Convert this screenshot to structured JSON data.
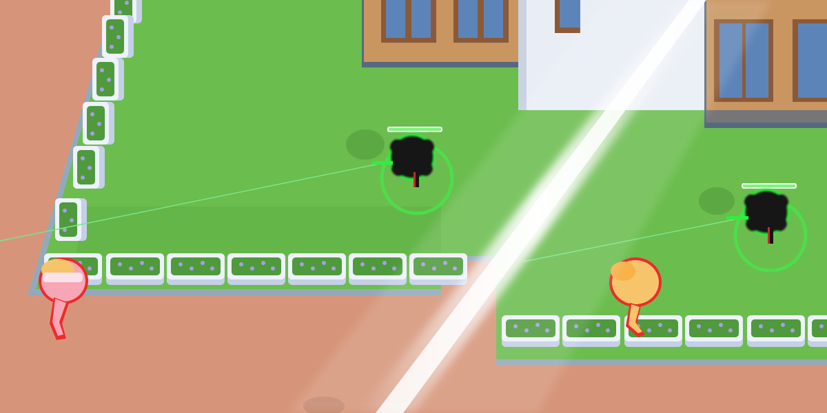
{
  "scene": {
    "colors": {
      "ground": "#d6957a",
      "lawn": "#6bbd4e",
      "lawn_shadow": "#5aa843",
      "curb": "#93a9ba",
      "planter": "#eef2fb",
      "planter_shade": "#c4d0e6",
      "flowers": "#4f9a3c",
      "flower_dots": "#a79ee6",
      "building_wall": "#c99561",
      "building_dark": "#546a80",
      "window": "#5d84b8",
      "window_frame": "#8a5a38",
      "white_wall": "#e9eef5",
      "player_fur": "#141414",
      "player_outline": "#2cf03c",
      "ring": "#4be04b",
      "laser": "#79e58a",
      "health_bar": "#7ef27e",
      "enemy_pink": "#f7a6b6",
      "enemy_yellow": "#f6c46a",
      "enemy_outline": "#ee2a2a",
      "light_beam": "#ffffff"
    },
    "characters": [
      {
        "name": "player-fluffy-1",
        "kind": "player",
        "health": 1.0
      },
      {
        "name": "player-fluffy-2",
        "kind": "player",
        "health": 1.0
      },
      {
        "name": "enemy-pink",
        "kind": "enemy"
      },
      {
        "name": "enemy-yellow",
        "kind": "enemy"
      }
    ]
  }
}
